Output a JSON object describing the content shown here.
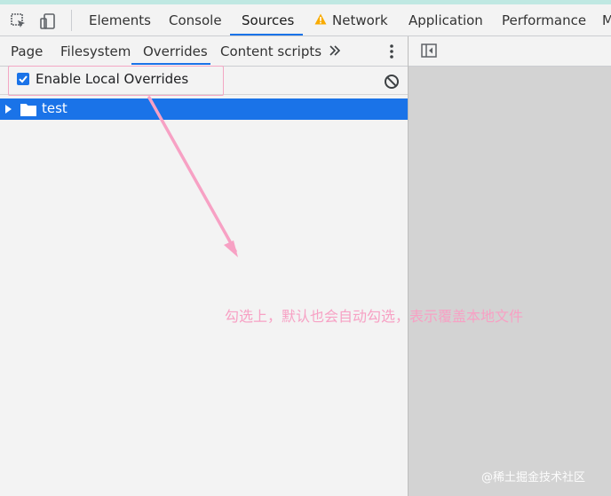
{
  "main_tabs": [
    {
      "label": "Elements"
    },
    {
      "label": "Console"
    },
    {
      "label": "Sources",
      "active": true
    },
    {
      "label": "Network",
      "has_warning": true
    },
    {
      "label": "Application"
    },
    {
      "label": "Performance"
    },
    {
      "label": "M"
    }
  ],
  "navigator": {
    "tabs": [
      {
        "label": "Page"
      },
      {
        "label": "Filesystem"
      },
      {
        "label": "Overrides",
        "active": true
      },
      {
        "label": "Content scripts"
      }
    ],
    "more_icon": "double-chevron-right-icon",
    "menu_icon": "kebab-menu-icon"
  },
  "overrides": {
    "enable_label": "Enable Local Overrides",
    "enabled": true,
    "clear_icon": "block-icon"
  },
  "tree": [
    {
      "label": "test",
      "icon": "folder-icon",
      "selected": true
    }
  ],
  "annotation": {
    "text": "勾选上，默认也会自动勾选，表示覆盖本地文件"
  },
  "watermark": "@稀土掘金技术社区",
  "colors": {
    "accent": "#1a73e8",
    "annotation": "#f7a1c4",
    "warning": "#f9ab00"
  }
}
